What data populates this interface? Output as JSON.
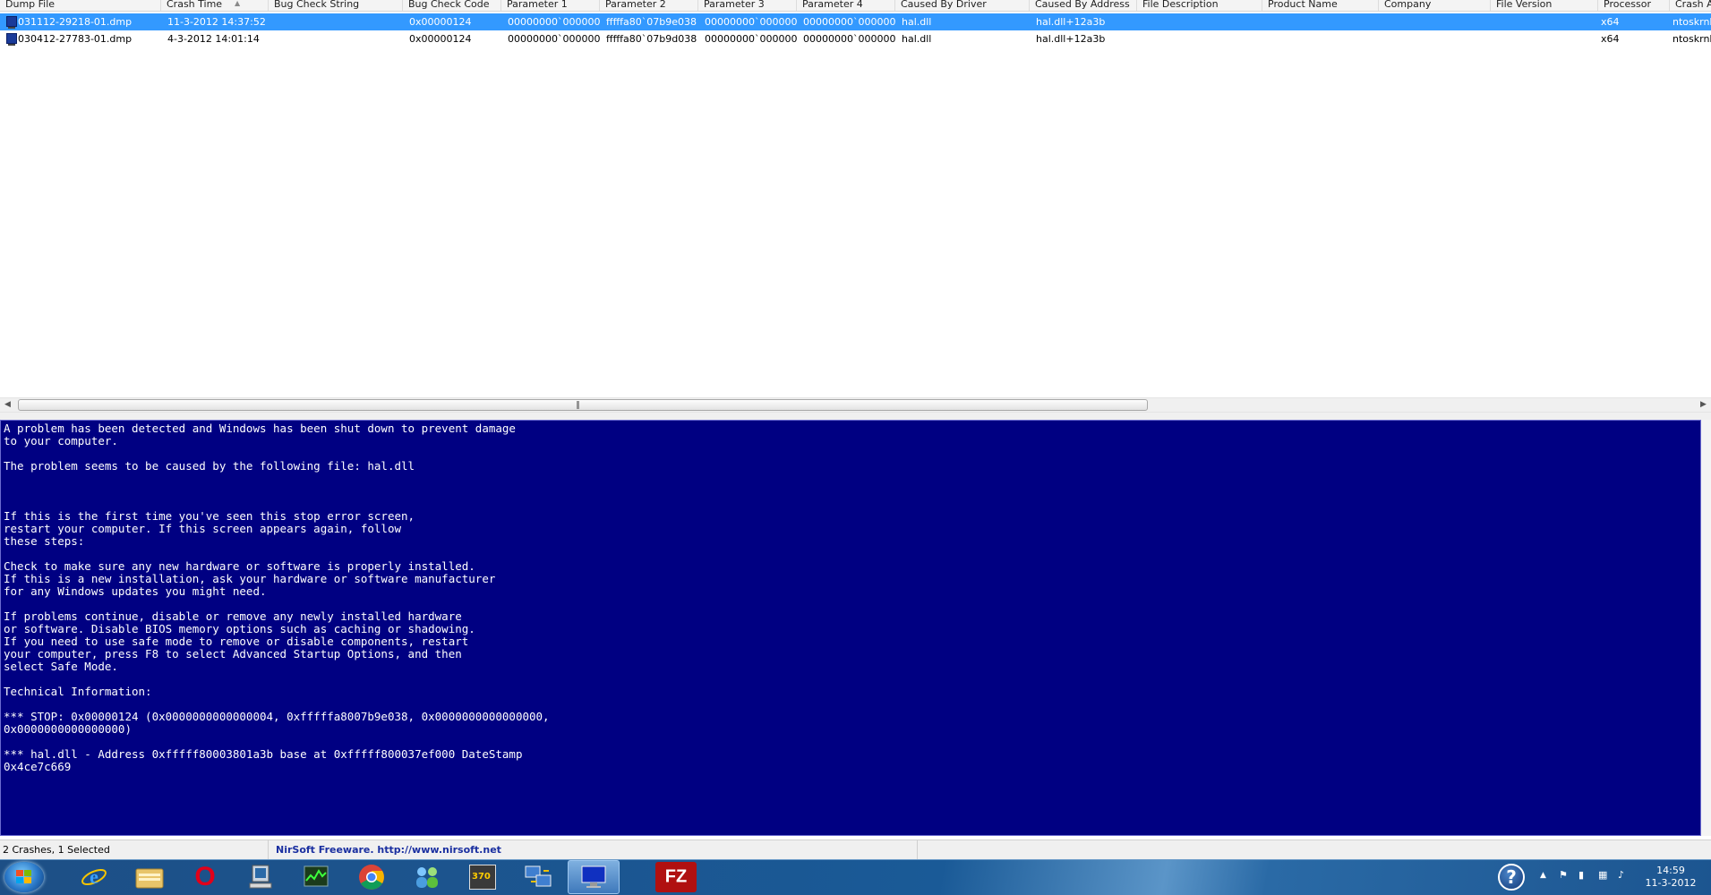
{
  "columns": [
    "Dump File",
    "Crash Time",
    "Bug Check String",
    "Bug Check Code",
    "Parameter 1",
    "Parameter 2",
    "Parameter 3",
    "Parameter 4",
    "Caused By Driver",
    "Caused By Address",
    "File Description",
    "Product Name",
    "Company",
    "File Version",
    "Processor",
    "Crash A"
  ],
  "rows": [
    [
      "031112-29218-01.dmp",
      "11-3-2012 14:37:52",
      "",
      "0x00000124",
      "00000000`000000...",
      "fffffa80`07b9e038",
      "00000000`000000...",
      "00000000`000000...",
      "hal.dll",
      "hal.dll+12a3b",
      "",
      "",
      "",
      "",
      "x64",
      "ntoskrnl"
    ],
    [
      "030412-27783-01.dmp",
      "4-3-2012 14:01:14",
      "",
      "0x00000124",
      "00000000`000000...",
      "fffffa80`07b9d038",
      "00000000`000000...",
      "00000000`000000...",
      "hal.dll",
      "hal.dll+12a3b",
      "",
      "",
      "",
      "",
      "x64",
      "ntoskrnl"
    ]
  ],
  "selected_row": 0,
  "scrollbar": {
    "left": "◀",
    "right": "▶",
    "grip": "|||"
  },
  "bsod": {
    "lines": [
      "A problem has been detected and Windows has been shut down to prevent damage",
      "to your computer.",
      "",
      "The problem seems to be caused by the following file: hal.dll",
      "",
      "",
      "",
      "If this is the first time you've seen this stop error screen,",
      "restart your computer. If this screen appears again, follow",
      "these steps:",
      "",
      "Check to make sure any new hardware or software is properly installed.",
      "If this is a new installation, ask your hardware or software manufacturer",
      "for any Windows updates you might need.",
      "",
      "If problems continue, disable or remove any newly installed hardware",
      "or software. Disable BIOS memory options such as caching or shadowing.",
      "If you need to use safe mode to remove or disable components, restart",
      "your computer, press F8 to select Advanced Startup Options, and then",
      "select Safe Mode.",
      "",
      "Technical Information:",
      "",
      "*** STOP: 0x00000124 (0x0000000000000004, 0xfffffa8007b9e038, 0x0000000000000000,",
      "0x0000000000000000)",
      "",
      "*** hal.dll - Address 0xfffff80003801a3b base at 0xfffff800037ef000 DateStamp",
      "0x4ce7c669"
    ],
    "background": "#000082"
  },
  "status": {
    "count": "2 Crashes, 1 Selected",
    "nirsoft": "NirSoft Freeware.  http://www.nirsoft.net"
  },
  "taskbar": {
    "apps": [
      "internet-explorer",
      "file-explorer",
      "opera",
      "computer",
      "task-manager",
      "chrome",
      "network",
      "media-player",
      "remote-desktop",
      "bluescreen-view",
      "filezilla"
    ],
    "active_app": "bluescreen-view",
    "opera_glyph": "O",
    "filezilla_glyph": "FZ",
    "media_glyph": "370",
    "help_glyph": "?"
  },
  "clock": {
    "time": "14:59",
    "date": "11-3-2012"
  },
  "accent": "#3399ff"
}
